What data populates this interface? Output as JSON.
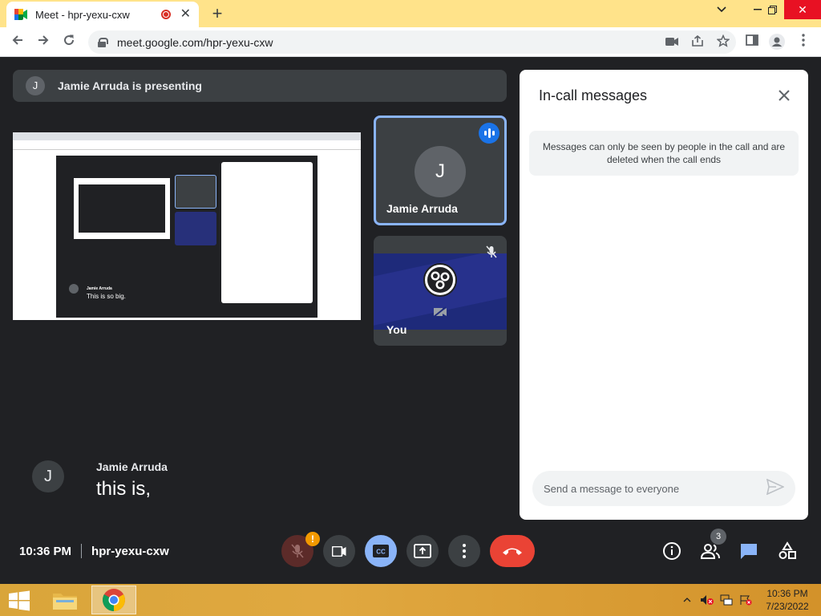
{
  "browser": {
    "tab_title": "Meet - hpr-yexu-cxw",
    "tab_close": "✕",
    "new_tab": "+",
    "url": "meet.google.com/hpr-yexu-cxw",
    "window_controls": {
      "minimize": "⌄",
      "restore": "❐",
      "close": "✕"
    }
  },
  "meet": {
    "presenting_banner": {
      "initial": "J",
      "text": "Jamie Arruda is presenting"
    },
    "shared_screen": {
      "caption_name": "Jamie Arruda",
      "caption_text": "This is so big."
    },
    "tiles": [
      {
        "name": "Jamie Arruda",
        "initial": "J",
        "speaking": true,
        "pinned_border_color": "#8ab4f8"
      },
      {
        "name": "You",
        "muted": true,
        "camera_off": true
      }
    ],
    "caption": {
      "initial": "J",
      "speaker": "Jamie Arruda",
      "text": "this is,"
    },
    "panel": {
      "title": "In-call messages",
      "notice": "Messages can only be seen by people in the call and are deleted when the call ends",
      "input_placeholder": "Send a message to everyone"
    },
    "bottom_bar": {
      "time": "10:36 PM",
      "meeting_code": "hpr-yexu-cxw",
      "mic_alert": "!",
      "participant_count": "3",
      "controls": [
        "mic-off-icon",
        "camera-icon",
        "captions-icon",
        "present-icon",
        "more-icon",
        "leave-call-icon"
      ],
      "right_icons": [
        "info-icon",
        "people-icon",
        "chat-icon",
        "activities-icon"
      ]
    },
    "colors": {
      "background": "#202124",
      "leave": "#ea4335",
      "captions_active": "#8ab4f8",
      "accent": "#1a73e8"
    }
  },
  "taskbar": {
    "time": "10:36 PM",
    "date": "7/23/2022",
    "apps": [
      "file-explorer-icon",
      "chrome-icon"
    ]
  }
}
